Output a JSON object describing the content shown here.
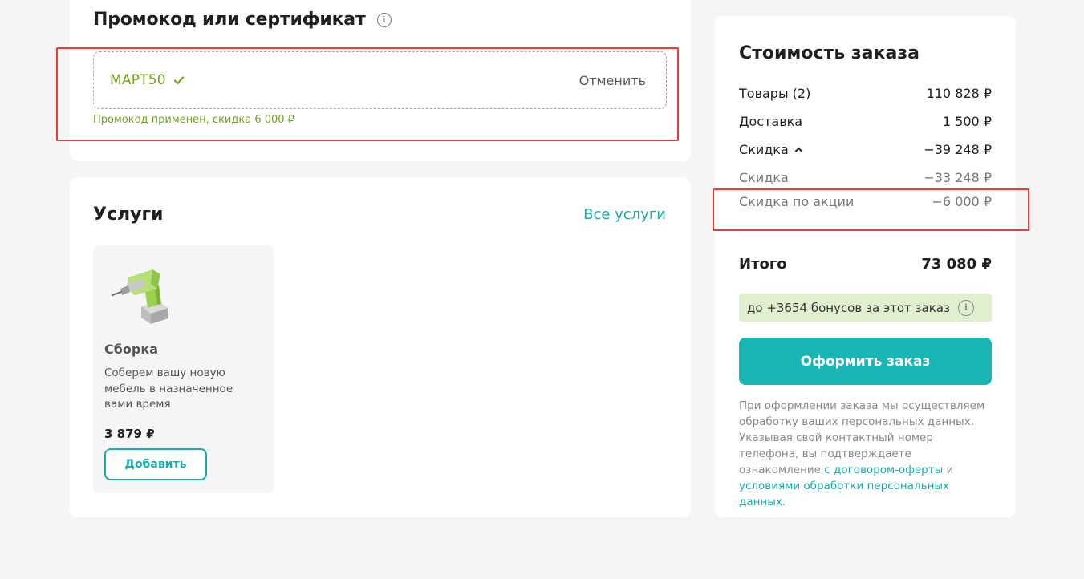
{
  "promo": {
    "title": "Промокод или сертификат",
    "code": "МАРТ50",
    "cancel_label": "Отменить",
    "status": "Промокод применен, скидка 6 000 ₽"
  },
  "services": {
    "title": "Услуги",
    "all_link": "Все услуги",
    "items": [
      {
        "name": "Сборка",
        "description": "Соберем вашу новую мебель в назначенное вами время",
        "price": "3 879 ₽",
        "add_label": "Добавить",
        "icon": "drill-icon"
      }
    ]
  },
  "summary": {
    "title": "Стоимость заказа",
    "rows": [
      {
        "label": "Товары (2)",
        "value": "110 828 ₽"
      },
      {
        "label": "Доставка",
        "value": "1 500 ₽"
      },
      {
        "label": "Скидка",
        "value": "−39 248 ₽"
      },
      {
        "label": "Скидка",
        "value": "−33 248 ₽"
      },
      {
        "label": "Скидка по акции",
        "value": "−6 000 ₽"
      }
    ],
    "total_label": "Итого",
    "total_value": "73 080 ₽",
    "bonus_text": "до +3654 бонусов за этот заказ",
    "checkout_label": "Оформить заказ",
    "legal": {
      "text": "При оформлении заказа мы осуществляем обработку ваших персональных данных. Указывая свой контактный номер телефона, вы подтверждаете ознакомление",
      "link1": "с договором-оферты",
      "and": "и",
      "link2": "условиями обработки персональных данных."
    }
  },
  "colors": {
    "accent": "#1ab5b5",
    "success": "#6fa318",
    "highlight": "#ef3b36",
    "bonus_bg": "#e1efcf"
  }
}
